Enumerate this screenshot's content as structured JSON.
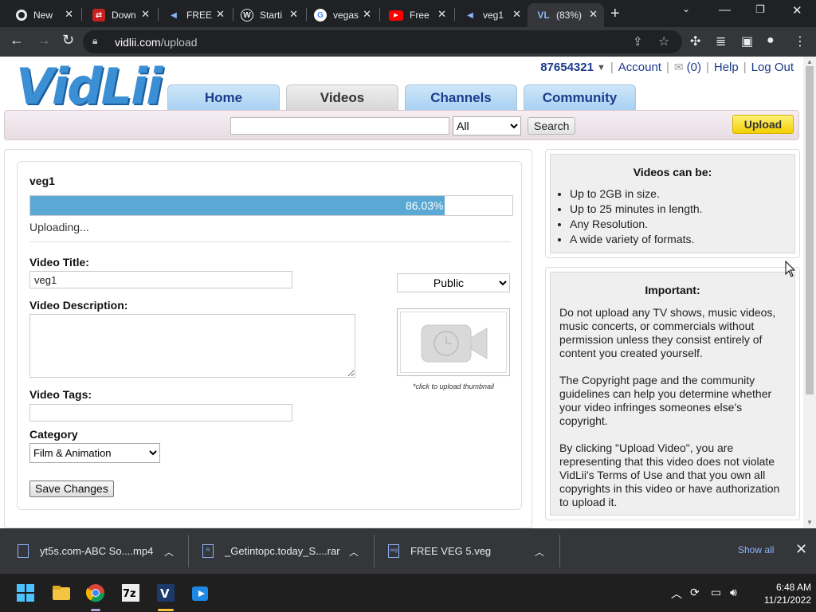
{
  "browser": {
    "tabs": [
      {
        "title": "New",
        "fav": "chrome-icon",
        "fav_color": "#e8eaed"
      },
      {
        "title": "Down",
        "fav": "download-site-icon",
        "fav_color": "#c5221f"
      },
      {
        "title": "FREE",
        "fav": "vidlii-icon",
        "fav_color": "#8ab4f8"
      },
      {
        "title": "Starti",
        "fav": "wordpress-icon",
        "fav_color": "#e8eaed"
      },
      {
        "title": "vegas",
        "fav": "google-icon",
        "fav_color": "#e8eaed"
      },
      {
        "title": "Free",
        "fav": "youtube-icon",
        "fav_color": "#ff0000"
      },
      {
        "title": "veg1",
        "fav": "vidlii-icon",
        "fav_color": "#8ab4f8"
      },
      {
        "title": "(83%)",
        "fav": "vidlii-logo-icon",
        "fav_color": "#8ab4f8"
      }
    ],
    "url_domain": "vidlii.com",
    "url_path": "/upload"
  },
  "site": {
    "logo": "VidLii",
    "user_id": "87654321",
    "account": "Account",
    "inbox_count": "(0)",
    "help": "Help",
    "logout": "Log Out",
    "nav": [
      "Home",
      "Videos",
      "Channels",
      "Community"
    ],
    "search_scope": "All",
    "search_button": "Search",
    "upload_button": "Upload"
  },
  "upload": {
    "file_name": "veg1",
    "progress_label": "86.03%",
    "progress_fraction": 0.8603,
    "status": "Uploading...",
    "title_label": "Video Title:",
    "title_value": "veg1",
    "privacy": "Public",
    "description_label": "Video Description:",
    "description_value": "",
    "thumbnail_caption": "*click to upload thumbnail",
    "tags_label": "Video Tags:",
    "tags_value": "",
    "category_label": "Category",
    "category_value": "Film & Animation",
    "save_button": "Save Changes"
  },
  "sidebar": {
    "info_title": "Videos can be:",
    "info_items": [
      "Up to 2GB in size.",
      "Up to 25 minutes in length.",
      "Any Resolution.",
      "A wide variety of formats."
    ],
    "important_title": "Important:",
    "important_paragraphs": [
      "Do not upload any TV shows, music videos, music concerts, or commercials without permission unless they consist entirely of content you created yourself.",
      "The Copyright page and the community guidelines can help you determine whether your video infringes someones else's copyright.",
      "By clicking \"Upload Video\", you are representing that this video does not violate VidLii's Terms of Use and that you own all copyrights in this video or have authorization to upload it."
    ]
  },
  "downloads": {
    "items": [
      {
        "name": "yt5s.com-ABC So....mp4"
      },
      {
        "name": "_Getintopc.today_S....rar"
      },
      {
        "name": "FREE VEG 5.veg"
      }
    ],
    "show_all": "Show all"
  },
  "taskbar": {
    "time": "6:48 AM",
    "date": "11/21/2022"
  }
}
